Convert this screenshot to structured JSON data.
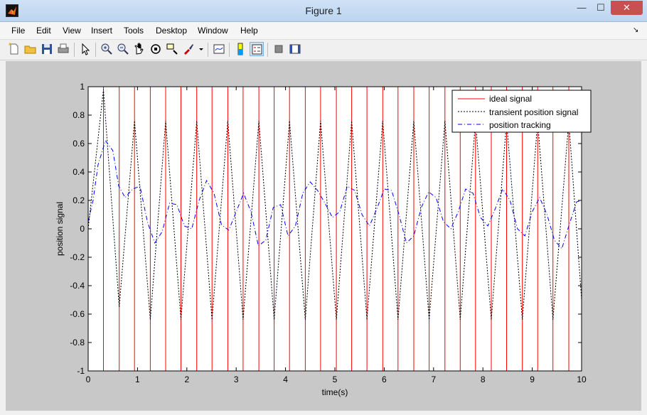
{
  "window": {
    "title": "Figure 1",
    "min_glyph": "—",
    "max_glyph": "☐",
    "close_glyph": "✕"
  },
  "menu": [
    "File",
    "Edit",
    "View",
    "Insert",
    "Tools",
    "Desktop",
    "Window",
    "Help"
  ],
  "menu_arrow": "↘",
  "toolbar": [
    "new-figure-icon",
    "open-file-icon",
    "save-icon",
    "print-icon",
    "edit-plot-icon",
    "zoom-in-icon",
    "zoom-out-icon",
    "pan-icon",
    "rotate-3d-icon",
    "data-cursor-icon",
    "brush-icon",
    "brush-dropdown-icon",
    "link-plot-icon",
    "colorbar-icon",
    "legend-icon",
    "hide-plot-tools-icon",
    "show-plot-tools-icon"
  ],
  "chart_data": {
    "type": "line",
    "xlabel": "time(s)",
    "ylabel": "position signal",
    "xlim": [
      0,
      10
    ],
    "ylim": [
      -1,
      1
    ],
    "xticks": [
      "0",
      "1",
      "2",
      "3",
      "4",
      "5",
      "6",
      "7",
      "8",
      "9",
      "10"
    ],
    "yticks": [
      "1",
      "0.8",
      "0.6",
      "0.4",
      "0.2",
      "0",
      "-0.2",
      "-0.4",
      "-0.6",
      "-0.8",
      "-1"
    ],
    "grid": false,
    "legend_position": "top-right",
    "colors": {
      "ideal": "#ff0000",
      "transient": "#000000",
      "tracking": "#0000ff",
      "axes_bg": "#ffffff",
      "figure_bg": "#c8c8c8"
    },
    "series": [
      {
        "name": "ideal signal",
        "style": "solid",
        "x": [
          0,
          0.31,
          0.31,
          0.63,
          0.63,
          0.94,
          0.94,
          1.26,
          1.26,
          1.57,
          1.57,
          1.88,
          1.88,
          2.2,
          2.2,
          2.51,
          2.51,
          2.83,
          2.83,
          3.14,
          3.14,
          3.46,
          3.46,
          3.77,
          3.77,
          4.08,
          4.08,
          4.4,
          4.4,
          4.71,
          4.71,
          5.03,
          5.03,
          5.34,
          5.34,
          5.65,
          5.65,
          5.97,
          5.97,
          6.28,
          6.28,
          6.6,
          6.6,
          6.91,
          6.91,
          7.23,
          7.23,
          7.54,
          7.54,
          7.85,
          7.85,
          8.17,
          8.17,
          8.48,
          8.48,
          8.8,
          8.8,
          9.11,
          9.11,
          9.42,
          9.42,
          9.74,
          9.74,
          10
        ],
        "y": [
          1,
          1,
          -1,
          -1,
          1,
          1,
          -1,
          -1,
          1,
          1,
          -1,
          -1,
          1,
          1,
          -1,
          -1,
          1,
          1,
          -1,
          -1,
          1,
          1,
          -1,
          -1,
          1,
          1,
          -1,
          -1,
          1,
          1,
          -1,
          -1,
          1,
          1,
          -1,
          -1,
          1,
          1,
          -1,
          -1,
          1,
          1,
          -1,
          -1,
          1,
          1,
          -1,
          -1,
          1,
          1,
          -1,
          -1,
          1,
          1,
          -1,
          -1,
          1,
          1,
          -1,
          -1,
          1,
          1,
          -1,
          -1
        ]
      },
      {
        "name": "transient position signal",
        "style": "dotted",
        "x": [
          0,
          0.31,
          0.63,
          0.94,
          1.26,
          1.57,
          1.88,
          2.2,
          2.51,
          2.83,
          3.14,
          3.46,
          3.77,
          4.08,
          4.4,
          4.71,
          5.03,
          5.34,
          5.65,
          5.97,
          6.28,
          6.6,
          6.91,
          7.23,
          7.54,
          7.85,
          8.17,
          8.48,
          8.8,
          9.11,
          9.42,
          9.74,
          10
        ],
        "y": [
          0,
          0.98,
          -0.55,
          0.76,
          -0.64,
          0.76,
          -0.64,
          0.76,
          -0.64,
          0.76,
          -0.64,
          0.76,
          -0.64,
          0.76,
          -0.64,
          0.76,
          -0.64,
          0.76,
          -0.64,
          0.76,
          -0.64,
          0.76,
          -0.64,
          0.76,
          -0.64,
          0.76,
          -0.64,
          0.76,
          -0.64,
          0.76,
          -0.64,
          0.76,
          -0.5
        ]
      },
      {
        "name": "position tracking",
        "style": "dashdot",
        "x": [
          0,
          0.1,
          0.2,
          0.35,
          0.5,
          0.62,
          0.75,
          0.9,
          1.05,
          1.2,
          1.35,
          1.5,
          1.65,
          1.8,
          1.95,
          2.1,
          2.25,
          2.4,
          2.55,
          2.7,
          2.85,
          3.0,
          3.15,
          3.3,
          3.45,
          3.6,
          3.75,
          3.9,
          4.05,
          4.2,
          4.35,
          4.5,
          4.65,
          4.8,
          4.95,
          5.1,
          5.25,
          5.4,
          5.55,
          5.7,
          5.85,
          6.0,
          6.15,
          6.3,
          6.45,
          6.6,
          6.75,
          6.9,
          7.05,
          7.2,
          7.35,
          7.5,
          7.65,
          7.8,
          7.95,
          8.1,
          8.25,
          8.4,
          8.55,
          8.7,
          8.85,
          9.0,
          9.15,
          9.3,
          9.45,
          9.6,
          9.75,
          9.9,
          10
        ],
        "y": [
          0.05,
          0.2,
          0.45,
          0.62,
          0.55,
          0.3,
          0.22,
          0.28,
          0.3,
          0.05,
          -0.1,
          -0.02,
          0.18,
          0.17,
          0.02,
          0.0,
          0.2,
          0.34,
          0.25,
          0.03,
          -0.01,
          0.12,
          0.25,
          0.12,
          -0.12,
          -0.08,
          0.15,
          0.17,
          -0.05,
          0.02,
          0.25,
          0.33,
          0.27,
          0.18,
          0.08,
          0.12,
          0.3,
          0.27,
          0.1,
          0.02,
          0.14,
          0.28,
          0.27,
          0.1,
          -0.1,
          -0.05,
          0.15,
          0.26,
          0.22,
          0.05,
          0.0,
          0.12,
          0.28,
          0.25,
          0.08,
          0.02,
          0.14,
          0.28,
          0.2,
          0.0,
          -0.05,
          0.12,
          0.22,
          0.1,
          -0.08,
          -0.14,
          0.03,
          0.19,
          0.2
        ]
      }
    ]
  }
}
